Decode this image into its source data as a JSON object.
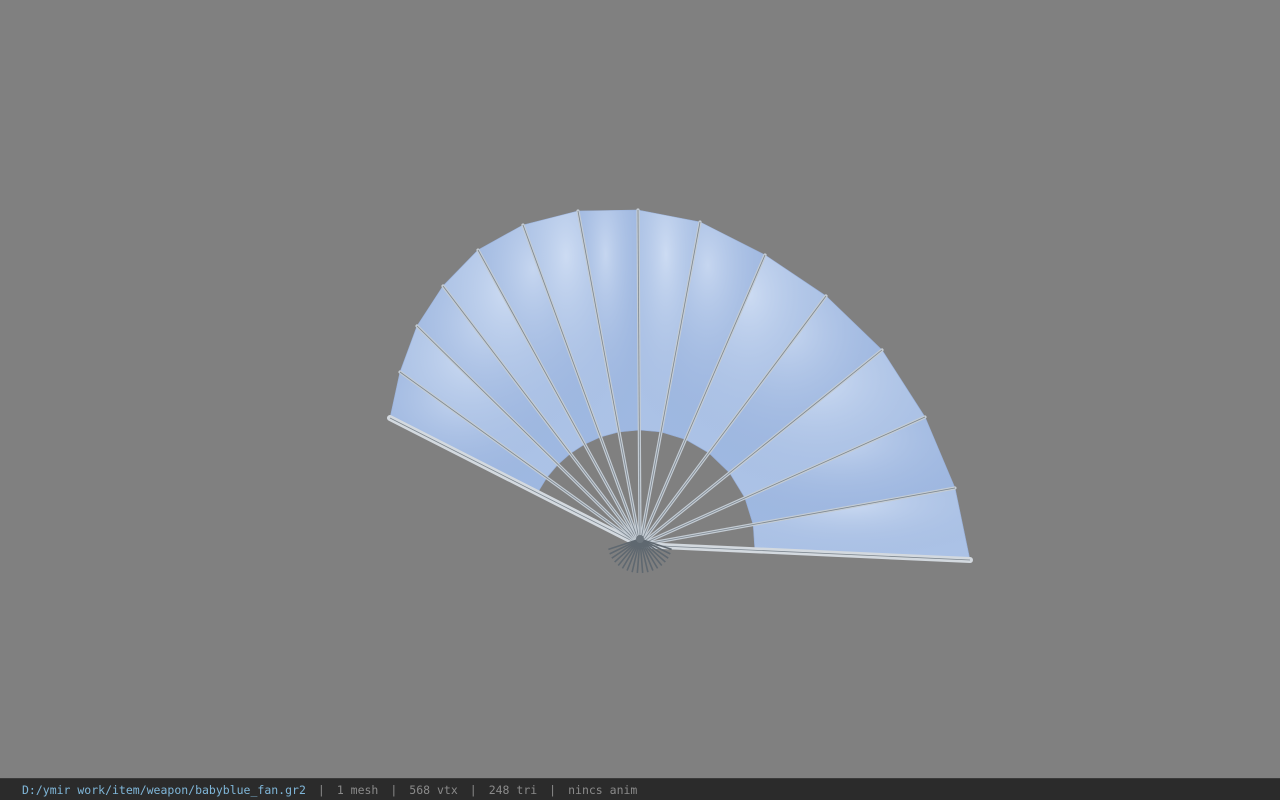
{
  "viewer": {
    "background_color": "#808080",
    "model": {
      "name": "babyblue_fan",
      "icon": "folding-fan-model",
      "paper_color": "#a9c2e6",
      "rib_color": "#c4ccd4"
    }
  },
  "status_bar": {
    "file_path": "D:/ymir work/item/weapon/babyblue_fan.gr2",
    "mesh_count": "1 mesh",
    "vertex_count": "568 vtx",
    "triangle_count": "248 tri",
    "anim_status": "nincs anim",
    "separator": "|",
    "path_color": "#7fb6d8",
    "text_color": "#8a8a8a",
    "background": "#2b2b2b"
  }
}
